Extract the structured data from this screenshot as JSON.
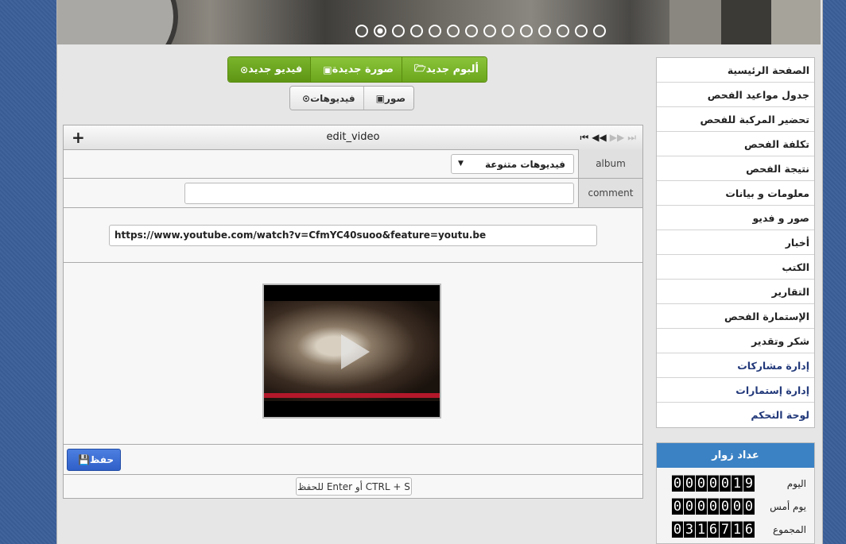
{
  "banner": {
    "slides": 14,
    "active_slide": 2
  },
  "toolbar": {
    "new_album": "ألبوم جديد",
    "new_image": "صورة جديدة",
    "new_video": "فيديو جديد",
    "images": "صور",
    "videos": "فيديوهات"
  },
  "panel": {
    "title": "edit_video",
    "add_symbol": "+",
    "album_label": "album",
    "album_value": "فيديوهات متنوعة",
    "comment_label": "comment",
    "comment_value": "",
    "url_value": "https://www.youtube.com/watch?v=CfmYC40suoo&feature=youtu.be",
    "save_label": "حفظ",
    "hint": "CTRL + S أو Enter للحفظ"
  },
  "sidebar": {
    "items": [
      {
        "label": "الصفحة الرئيسية"
      },
      {
        "label": "جدول مواعيد الفحص"
      },
      {
        "label": "تحضير المركبة للفحص"
      },
      {
        "label": "تكلفة الفحص"
      },
      {
        "label": "نتيجة الفحص"
      },
      {
        "label": "معلومات و بيانات"
      },
      {
        "label": "صور و فديو"
      },
      {
        "label": "أخبار"
      },
      {
        "label": "الكتب"
      },
      {
        "label": "التقارير"
      },
      {
        "label": "الإستمارة الفحص"
      },
      {
        "label": "شكر وتقدير"
      },
      {
        "label": "إدارة مشاركات"
      },
      {
        "label": "إدارة إستمارات"
      },
      {
        "label": "لوحة التحكم"
      }
    ]
  },
  "counter": {
    "title": "عداد زوار",
    "today_label": "اليوم",
    "today_value": "0000019",
    "yesterday_label": "يوم أمس",
    "yesterday_value": "0000000",
    "total_label": "المجموع",
    "total_value": "0316716"
  }
}
